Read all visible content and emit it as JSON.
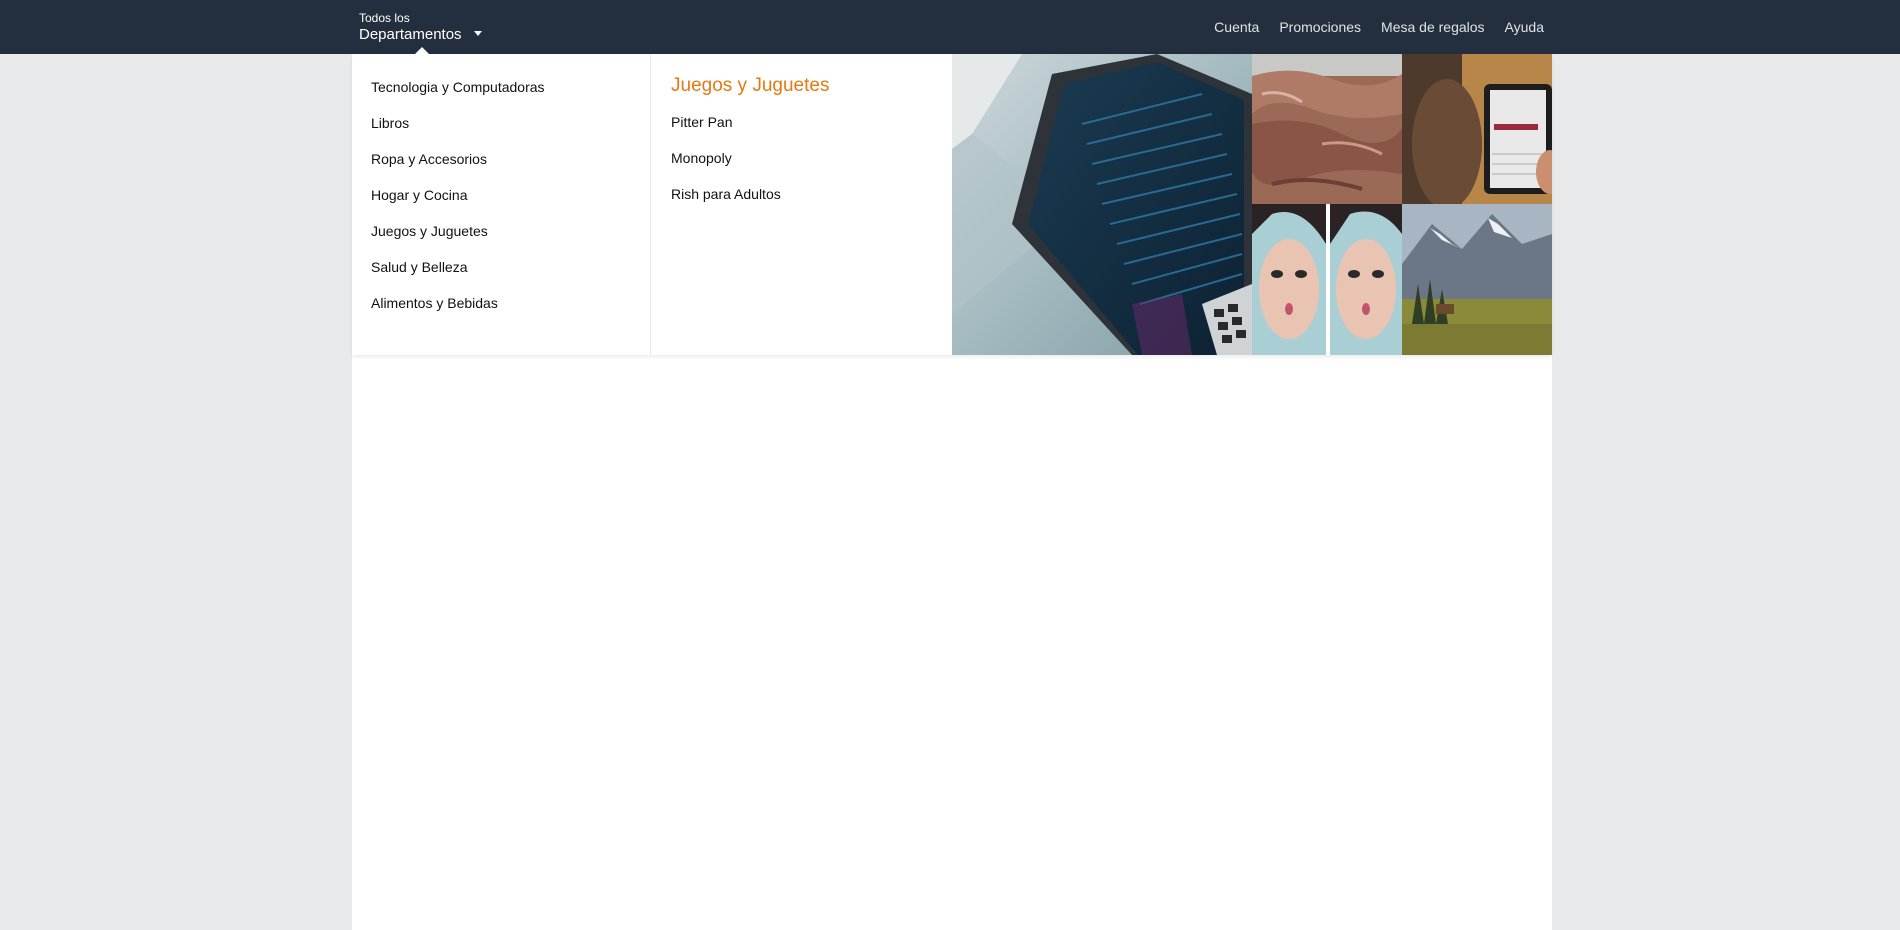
{
  "header": {
    "dept_small": "Todos los",
    "dept_big": "Departamentos",
    "nav": [
      "Cuenta",
      "Promociones",
      "Mesa de regalos",
      "Ayuda"
    ]
  },
  "menu": {
    "departments": [
      "Tecnologia y Computadoras",
      "Libros",
      "Ropa y Accesorios",
      "Hogar y Cocina",
      "Juegos y Juguetes",
      "Salud y Belleza",
      "Alimentos y Bebidas"
    ],
    "active_title": "Juegos y Juguetes",
    "sub_items": [
      "Pitter Pan",
      "Monopoly",
      "Rish para Adultos"
    ]
  },
  "colors": {
    "topbar": "#232f3e",
    "accent": "#e47911"
  },
  "icons": {
    "dropdown": "caret-down-icon"
  }
}
